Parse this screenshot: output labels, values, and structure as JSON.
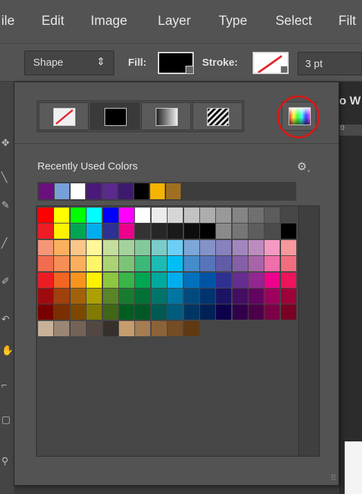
{
  "menu": {
    "items": [
      "ile",
      "Edit",
      "Image",
      "Layer",
      "Type",
      "Select",
      "Filt"
    ]
  },
  "options": {
    "shape_mode": "Shape",
    "fill_label": "Fill:",
    "stroke_label": "Stroke:",
    "stroke_width": "3 pt"
  },
  "doc": {
    "title_fragment": "o W",
    "ruler_fragment": "0"
  },
  "panel": {
    "fill_types": [
      "no-color",
      "solid-color",
      "gradient",
      "pattern"
    ],
    "active_fill_type": "solid-color",
    "picker_icon": "color-picker-icon",
    "recent_label": "Recently Used Colors",
    "recent_colors": [
      "#6a0f7e",
      "#78a0d8",
      "#ffffff",
      "#4a1a7a",
      "#5b2a8c",
      "#3d1a70",
      "#000000",
      "#f5b400",
      "#a07020"
    ],
    "swatch_rows": [
      [
        "#ff0000",
        "#ffff00",
        "#00ff00",
        "#00ffff",
        "#0000ff",
        "#ff00ff",
        "#ffffff",
        "#ebebeb",
        "#d6d6d6",
        "#c2c2c2",
        "#adadad",
        "#999999",
        "#858585",
        "#707070",
        "#5c5c5c",
        "#474747"
      ],
      [
        "#ed1c24",
        "#fff200",
        "#00a651",
        "#00aeef",
        "#2e3192",
        "#ec008c",
        "#333333",
        "#262626",
        "#1a1a1a",
        "#0d0d0d",
        "#000000",
        "#8a8a8a",
        "#767676",
        "#5d5d5d",
        "#4b4b4b",
        "#000000"
      ],
      [
        "#f69679",
        "#fbaf5d",
        "#fdc689",
        "#fff799",
        "#c4df9b",
        "#a3d39c",
        "#82ca9c",
        "#7accc8",
        "#6dcff6",
        "#7da7d9",
        "#8393ca",
        "#8781bd",
        "#a186be",
        "#bd8cbf",
        "#f49ac2",
        "#f6989d"
      ],
      [
        "#f26c4f",
        "#f68e56",
        "#fbaf5d",
        "#fff568",
        "#acd373",
        "#7cc576",
        "#3cb878",
        "#1cbbb4",
        "#00bff3",
        "#448ccb",
        "#5674b9",
        "#605ca8",
        "#8560a8",
        "#a864a8",
        "#f06eaa",
        "#f26d7d"
      ],
      [
        "#ed1c24",
        "#f26522",
        "#f7941d",
        "#fff200",
        "#8dc63f",
        "#39b54a",
        "#00a651",
        "#00a99d",
        "#00aeef",
        "#0072bc",
        "#0054a6",
        "#2e3192",
        "#662d91",
        "#92278f",
        "#ec008c",
        "#ed145b"
      ],
      [
        "#9e0b0f",
        "#a0410d",
        "#a36209",
        "#aba000",
        "#598527",
        "#197b30",
        "#007236",
        "#00746b",
        "#0076a3",
        "#004a80",
        "#003471",
        "#1b1464",
        "#440e62",
        "#630460",
        "#9e005d",
        "#9e0039"
      ],
      [
        "#790000",
        "#7b2e00",
        "#7d4900",
        "#827b00",
        "#406618",
        "#005e20",
        "#005826",
        "#005952",
        "#005b7f",
        "#003663",
        "#002157",
        "#0d004c",
        "#32004b",
        "#4b0049",
        "#7b0046",
        "#7a0026"
      ],
      [
        "#c7b299",
        "#998675",
        "#736357",
        "#534741",
        "#37302d",
        "#c69c6d",
        "#a67c52",
        "#8c6239",
        "#754c24",
        "#603913"
      ]
    ]
  }
}
